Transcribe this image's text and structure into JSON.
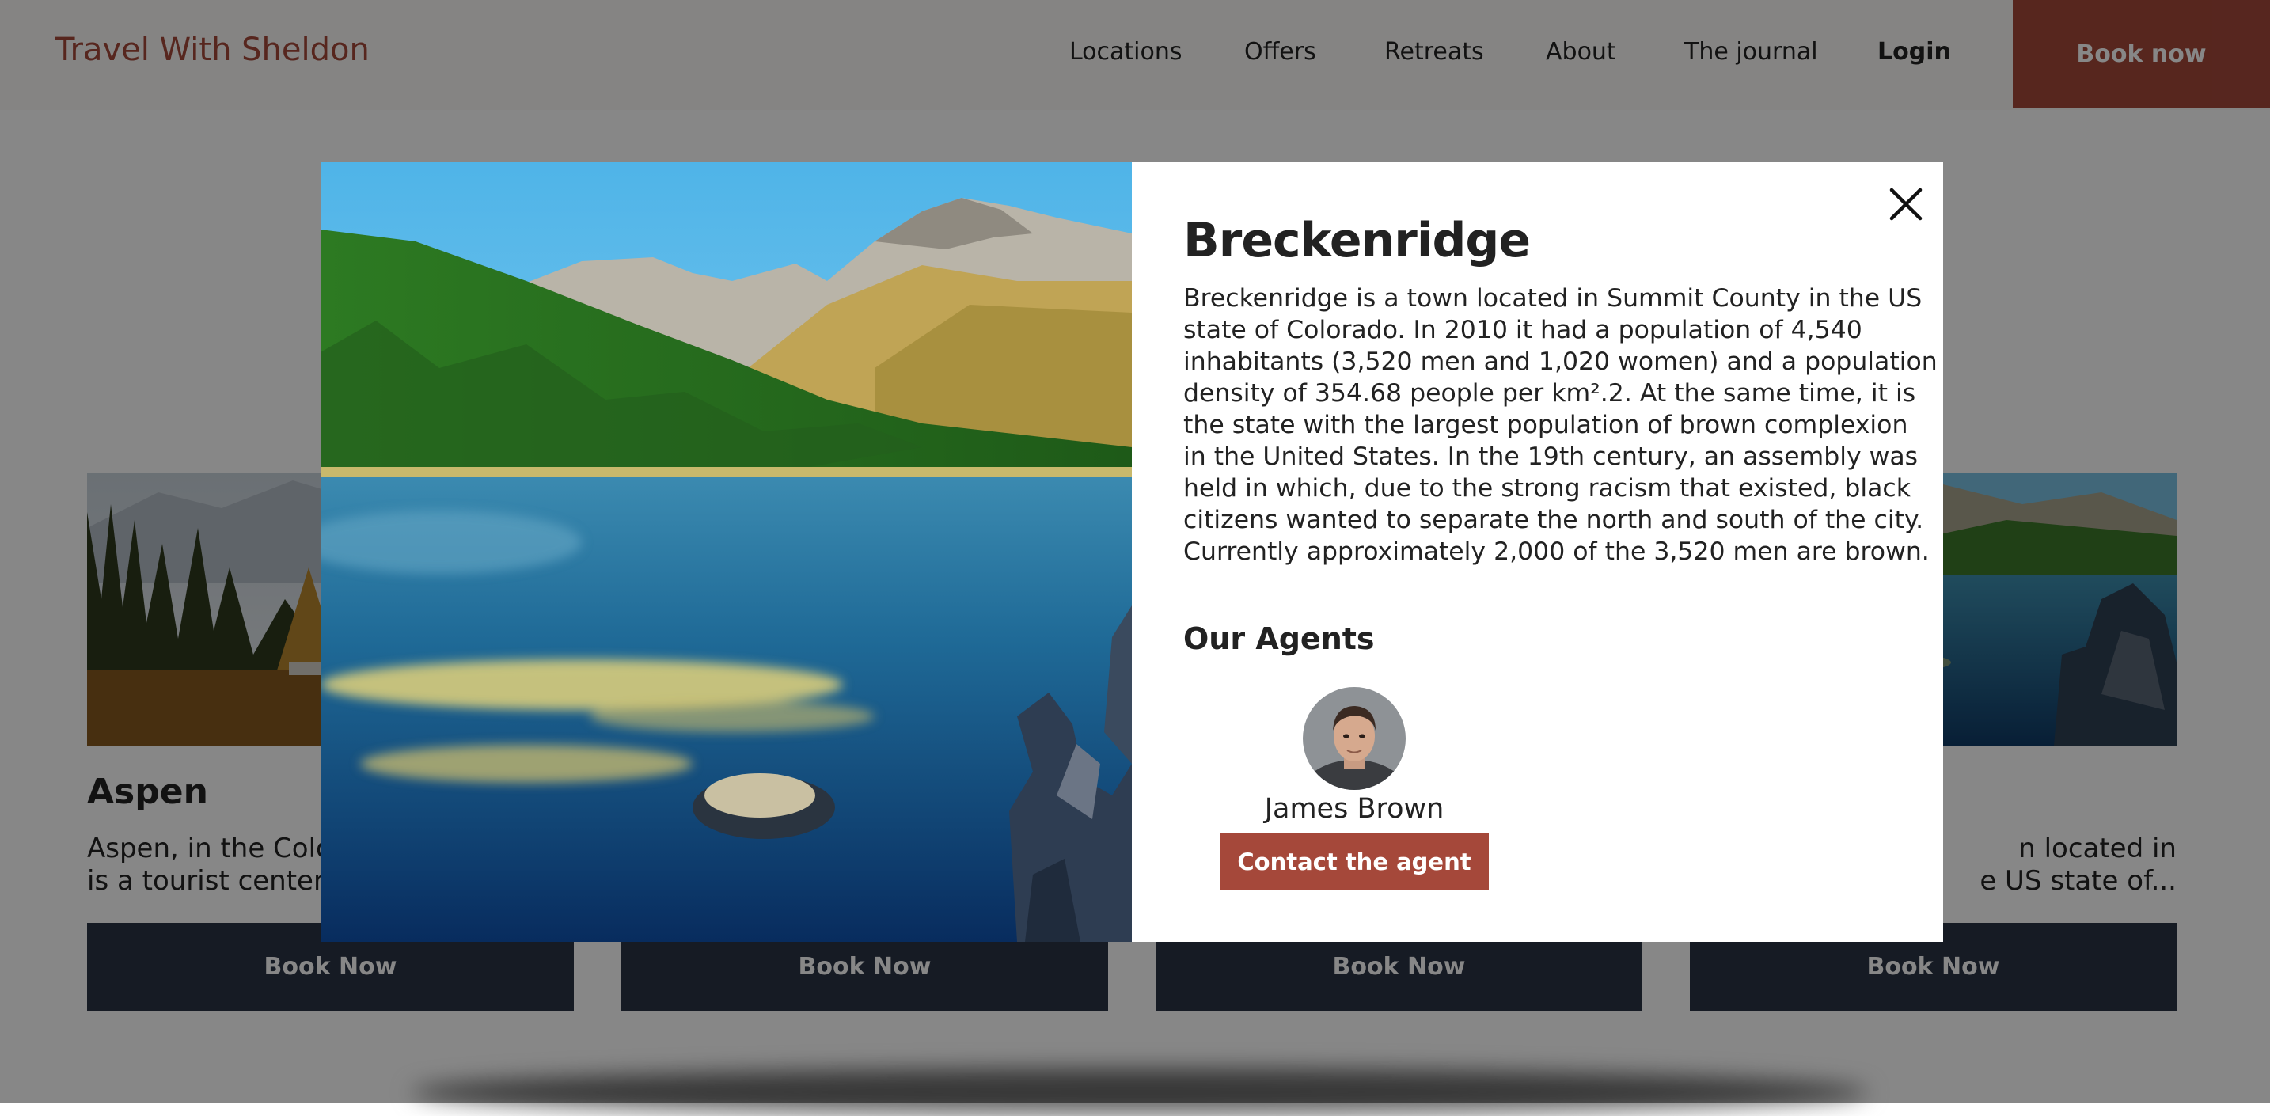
{
  "header": {
    "logo": "Travel With Sheldon",
    "nav": [
      "Locations",
      "Offers",
      "Retreats",
      "About",
      "The journal"
    ],
    "login_label": "Login",
    "book_label": "Book now"
  },
  "cards": [
    {
      "title": "Aspen",
      "description": "Aspen, in the Colora\nis a tourist center an",
      "button": "Book Now"
    },
    {
      "title": "",
      "description": "",
      "button": "Book Now"
    },
    {
      "title": "",
      "description": "",
      "button": "Book Now"
    },
    {
      "title": "",
      "description": "n located in\ne US state of...",
      "button": "Book Now"
    }
  ],
  "modal": {
    "title": "Breckenridge",
    "description": "Breckenridge is a town located in Summit County in the US\nstate of Colorado. In 2010 it had a population of 4,540\ninhabitants (3,520 men and 1,020 women) and a population\ndensity of 354.68 people per km².2. At the same time, it is\nthe state with the largest population of brown complexion\nin the United States. In the 19th century, an assembly was\nheld in which, due to the strong racism that existed, black\ncitizens wanted to separate the north and south of the city.\nCurrently approximately 2,000 of the 3,520 men are brown.",
    "agents_title": "Our Agents",
    "agent_name": "James Brown",
    "contact_label": "Contact the agent"
  },
  "icons": {
    "close": "close-icon",
    "avatar": "agent-avatar"
  },
  "colors": {
    "brand": "#a5483a",
    "card_button": "#2b3445",
    "overlay": "rgba(0,0,0,0.47)"
  }
}
